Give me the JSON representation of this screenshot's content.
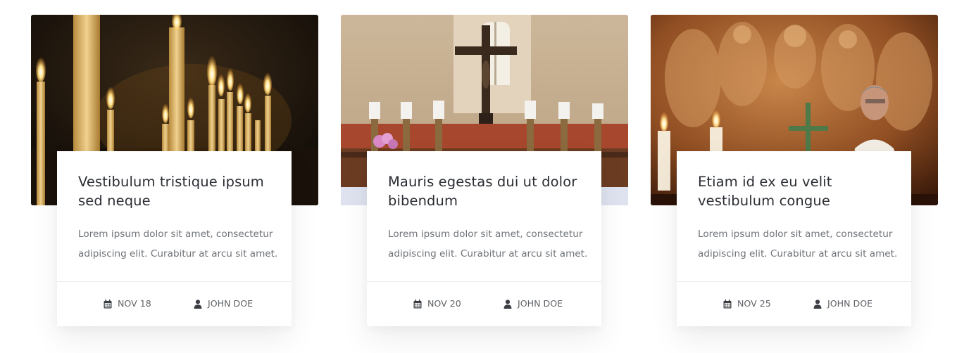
{
  "posts": [
    {
      "title": "Vestibulum tristique ipsum sed neque",
      "excerpt": "Lorem ipsum dolor sit amet, consectetur adipiscing elit. Curabitur at arcu sit amet.",
      "date": "NOV 18",
      "author": "JOHN DOE",
      "image_subject": "lit candles",
      "date_icon": "calendar-icon",
      "author_icon": "user-icon"
    },
    {
      "title": "Mauris egestas dui ut dolor bibendum",
      "excerpt": "Lorem ipsum dolor sit amet, consectetur adipiscing elit. Curabitur at arcu sit amet.",
      "date": "NOV 20",
      "author": "JOHN DOE",
      "image_subject": "altar with crucifix",
      "date_icon": "calendar-icon",
      "author_icon": "user-icon"
    },
    {
      "title": "Etiam id ex eu velit vestibulum congue",
      "excerpt": "Lorem ipsum dolor sit amet, consectetur adipiscing elit. Curabitur at arcu sit amet.",
      "date": "NOV 25",
      "author": "JOHN DOE",
      "image_subject": "priest before carved altarpiece",
      "date_icon": "calendar-icon",
      "author_icon": "user-icon"
    }
  ],
  "colors": {
    "title": "#2a2d33",
    "excerpt": "#6f7378",
    "meta": "#5f6368",
    "divider": "#ececec"
  }
}
